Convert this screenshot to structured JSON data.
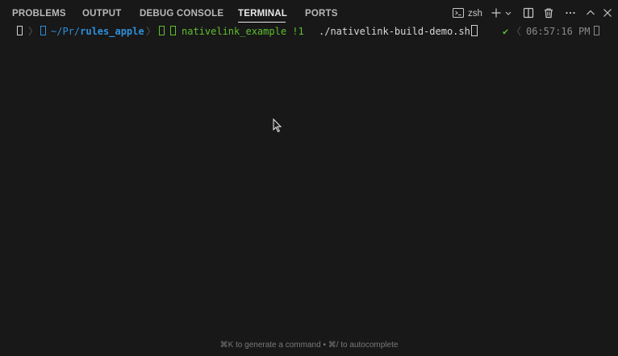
{
  "tabs": [
    {
      "label": "PROBLEMS",
      "active": false
    },
    {
      "label": "OUTPUT",
      "active": false
    },
    {
      "label": "DEBUG CONSOLE",
      "active": false
    },
    {
      "label": "TERMINAL",
      "active": true
    },
    {
      "label": "PORTS",
      "active": false
    }
  ],
  "toolbar": {
    "shell_label": "zsh",
    "icons": [
      "terminal-icon",
      "plus-icon",
      "chevron-down-icon",
      "split-icon",
      "trash-icon",
      "more-icon",
      "chevron-up-icon",
      "close-icon"
    ]
  },
  "prompt": {
    "path_prefix": "~/Pr/",
    "path_dir": "rules_apple",
    "branch": "nativelink_example !1",
    "command": "./nativelink-build-demo.sh",
    "status": "✔",
    "time": "06:57:16 PM"
  },
  "hint": "⌘K to generate a command • ⌘/ to autocomplete",
  "colors": {
    "background": "#181818",
    "path": "#2f8fd8",
    "git": "#5fbf2f",
    "text": "#d8d8d8"
  }
}
